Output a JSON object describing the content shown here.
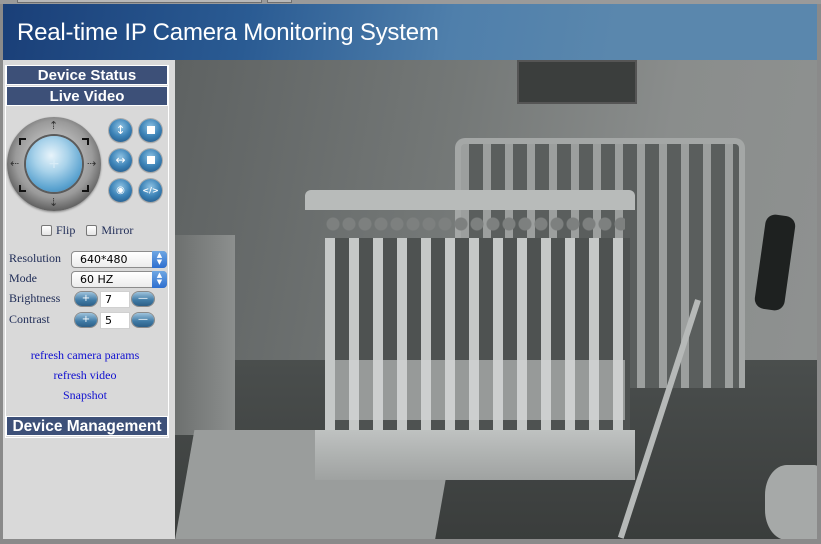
{
  "header": {
    "title": "Real-time IP Camera Monitoring System"
  },
  "sidebar": {
    "nav": {
      "device_status": "Device Status",
      "live_video": "Live Video",
      "device_management": "Device Management"
    },
    "ptz": {
      "center_icon": "plus-icon",
      "arrows": [
        "arrow-up",
        "arrow-down",
        "arrow-left",
        "arrow-right"
      ],
      "buttons": [
        {
          "name": "vertical-patrol",
          "icon": "vertical-arrows-icon",
          "glyph": "↕"
        },
        {
          "name": "stop-vertical-patrol",
          "icon": "stop-icon",
          "glyph": ""
        },
        {
          "name": "horizontal-patrol",
          "icon": "horizontal-arrows-icon",
          "glyph": "↔"
        },
        {
          "name": "stop-horizontal-patrol",
          "icon": "stop-icon",
          "glyph": ""
        },
        {
          "name": "io-on",
          "icon": "eye-icon",
          "glyph": "◉"
        },
        {
          "name": "io-off",
          "icon": "code-icon",
          "glyph": "</>"
        }
      ]
    },
    "options": {
      "flip_label": "Flip",
      "flip_checked": false,
      "mirror_label": "Mirror",
      "mirror_checked": false
    },
    "params": {
      "resolution_label": "Resolution",
      "resolution_value": "640*480",
      "mode_label": "Mode",
      "mode_value": "60 HZ",
      "brightness_label": "Brightness",
      "brightness_value": "7",
      "contrast_label": "Contrast",
      "contrast_value": "5",
      "plus_glyph": "+",
      "minus_glyph": "—"
    },
    "links": {
      "refresh_params": "refresh camera params",
      "refresh_video": "refresh video",
      "snapshot": "Snapshot"
    }
  },
  "video": {
    "description": "Live camera feed: night-vision view of a nursery with a crib"
  }
}
